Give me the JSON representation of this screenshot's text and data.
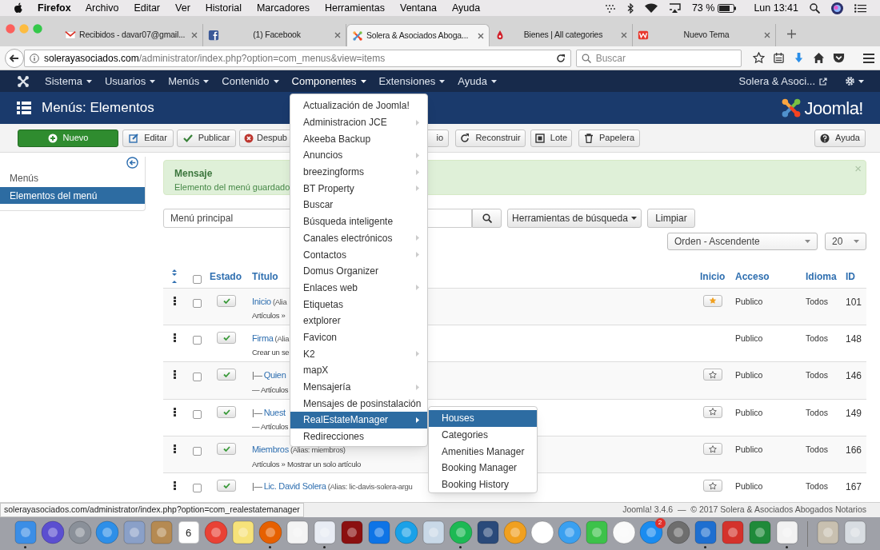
{
  "menubar": {
    "app": "Firefox",
    "items": [
      "Archivo",
      "Editar",
      "Ver",
      "Historial",
      "Marcadores",
      "Herramientas",
      "Ventana",
      "Ayuda"
    ],
    "battery": "73 %",
    "clock": "Lun 13:41"
  },
  "browser": {
    "tabs": [
      {
        "title": "Recibidos - davar07@gmail...",
        "selected": false
      },
      {
        "title": "(1) Facebook",
        "selected": false
      },
      {
        "title": "Solera & Asociados Aboga...",
        "selected": true
      },
      {
        "title": "Bienes | All categories",
        "selected": false
      },
      {
        "title": "Nuevo Tema",
        "selected": false
      }
    ],
    "url_host": "solerayasociados.com",
    "url_path": "/administrator/index.php?option=com_menus&view=items",
    "search_placeholder": "Buscar"
  },
  "admin_nav": {
    "items": [
      {
        "label": "Sistema",
        "selected": false
      },
      {
        "label": "Usuarios",
        "selected": false
      },
      {
        "label": "Menús",
        "selected": false
      },
      {
        "label": "Contenido",
        "selected": false
      },
      {
        "label": "Componentes",
        "selected": true
      },
      {
        "label": "Extensiones",
        "selected": false
      },
      {
        "label": "Ayuda",
        "selected": false
      }
    ],
    "site": "Solera & Asoci..."
  },
  "page_title": "Menús: Elementos",
  "logo": "Joomla!",
  "toolbar": {
    "buttons": [
      {
        "label": "Nuevo",
        "kind": "new"
      },
      {
        "label": "Editar",
        "kind": "edit"
      },
      {
        "label": "Publicar",
        "kind": "publish"
      },
      {
        "label": "Despub",
        "kind": "unpublish"
      },
      {
        "label": "io",
        "kind": "home"
      },
      {
        "label": "Reconstruir",
        "kind": "rebuild"
      },
      {
        "label": "Lote",
        "kind": "batch"
      },
      {
        "label": "Papelera",
        "kind": "trash"
      },
      {
        "label": "Ayuda",
        "kind": "help"
      }
    ]
  },
  "sidebar": {
    "items": [
      {
        "label": "Menús",
        "selected": false
      },
      {
        "label": "Elementos del menú",
        "selected": true
      }
    ]
  },
  "message": {
    "heading": "Mensaje",
    "text": "Elemento del menú guardado",
    "close": "×"
  },
  "filters": {
    "menu": "Menú principal",
    "tools": "Herramientas de búsqueda",
    "clear": "Limpiar",
    "ordering": "Orden - Ascendente",
    "limit": "20"
  },
  "table": {
    "select_all_checked": false,
    "columns": [
      "Estado",
      "Título",
      "Inicio",
      "Acceso",
      "Idioma",
      "ID"
    ],
    "rows": [
      {
        "prefix": "",
        "title": "Inicio",
        "alias": "(Alia",
        "meta": "Artículos »",
        "published": true,
        "home": true,
        "access": "Publico",
        "language": "Todos",
        "id": "101",
        "checked": false
      },
      {
        "prefix": "",
        "title": "Firma",
        "alias": "(Alia",
        "meta": "Crear un se",
        "published": true,
        "access": "Publico",
        "language": "Todos",
        "id": "148",
        "checked": false
      },
      {
        "prefix": "|—",
        "title": "Quien",
        "alias": "",
        "meta": "— Artículos",
        "published": true,
        "home": false,
        "access": "Publico",
        "language": "Todos",
        "id": "146",
        "checked": false
      },
      {
        "prefix": "|—",
        "title": "Nuest",
        "alias": "",
        "meta": "— Artículos",
        "published": true,
        "home": false,
        "access": "Publico",
        "language": "Todos",
        "id": "149",
        "checked": false
      },
      {
        "prefix": "",
        "title": "Miembros",
        "alias": "(Alias: miembros)",
        "meta": "Artículos » Mostrar un solo artículo",
        "published": true,
        "home": false,
        "access": "Publico",
        "language": "Todos",
        "id": "166",
        "checked": false
      },
      {
        "prefix": "|—",
        "title": "Lic. David Solera",
        "alias": "(Alias: lic-davis-solera-argu",
        "meta": "",
        "published": true,
        "home": false,
        "access": "Publico",
        "language": "Todos",
        "id": "167",
        "checked": false
      }
    ]
  },
  "components_menu": {
    "items": [
      {
        "label": "Actualización de Joomla!",
        "submenu": false,
        "selected": false
      },
      {
        "label": "Administracion JCE",
        "submenu": true,
        "selected": false
      },
      {
        "label": "Akeeba Backup",
        "submenu": false,
        "selected": false
      },
      {
        "label": "Anuncios",
        "submenu": true,
        "selected": false
      },
      {
        "label": "breezingforms",
        "submenu": true,
        "selected": false
      },
      {
        "label": "BT Property",
        "submenu": true,
        "selected": false
      },
      {
        "label": "Buscar",
        "submenu": false,
        "selected": false
      },
      {
        "label": "Búsqueda inteligente",
        "submenu": false,
        "selected": false
      },
      {
        "label": "Canales electrónicos",
        "submenu": true,
        "selected": false
      },
      {
        "label": "Contactos",
        "submenu": true,
        "selected": false
      },
      {
        "label": "Domus Organizer",
        "submenu": false,
        "selected": false
      },
      {
        "label": "Enlaces web",
        "submenu": true,
        "selected": false
      },
      {
        "label": "Etiquetas",
        "submenu": false,
        "selected": false
      },
      {
        "label": "extplorer",
        "submenu": false,
        "selected": false
      },
      {
        "label": "Favicon",
        "submenu": false,
        "selected": false
      },
      {
        "label": "K2",
        "submenu": true,
        "selected": false
      },
      {
        "label": "mapX",
        "submenu": false,
        "selected": false
      },
      {
        "label": "Mensajería",
        "submenu": true,
        "selected": false
      },
      {
        "label": "Mensajes de posinstalación",
        "submenu": false,
        "selected": false
      },
      {
        "label": "RealEstateManager",
        "submenu": true,
        "selected": true
      },
      {
        "label": "Redirecciones",
        "submenu": false,
        "selected": false
      }
    ],
    "submenu": [
      {
        "label": "Houses",
        "selected": true
      },
      {
        "label": "Categories",
        "selected": false
      },
      {
        "label": "Amenities Manager",
        "selected": false
      },
      {
        "label": "Booking Manager",
        "selected": false
      },
      {
        "label": "Booking History",
        "selected": false
      }
    ]
  },
  "status": {
    "link": "solerayasociados.com/administrator/index.php?option=com_realestatemanager",
    "footer": "Joomla! 3.4.6  —  © 2017 Solera & Asociados Abogados Notarios"
  },
  "dock": {
    "items": [
      {
        "kind": "app",
        "running": true
      },
      {
        "kind": "app",
        "running": false
      },
      {
        "kind": "app",
        "running": false
      },
      {
        "kind": "app",
        "running": false
      },
      {
        "kind": "app",
        "running": false
      },
      {
        "kind": "app",
        "running": false
      },
      {
        "kind": "app",
        "running": false,
        "label": "6"
      },
      {
        "kind": "app",
        "running": false
      },
      {
        "kind": "app",
        "running": false
      },
      {
        "kind": "app",
        "running": true
      },
      {
        "kind": "app",
        "running": false
      },
      {
        "kind": "app",
        "running": true
      },
      {
        "kind": "app",
        "running": false
      },
      {
        "kind": "app",
        "running": false
      },
      {
        "kind": "app",
        "running": false
      },
      {
        "kind": "app",
        "running": false
      },
      {
        "kind": "app",
        "running": true
      },
      {
        "kind": "app",
        "running": false
      },
      {
        "kind": "app",
        "running": false
      },
      {
        "kind": "app",
        "running": false
      },
      {
        "kind": "app",
        "running": false
      },
      {
        "kind": "app",
        "running": false
      },
      {
        "kind": "app",
        "running": false
      },
      {
        "kind": "app",
        "running": false,
        "badge": "2"
      },
      {
        "kind": "app",
        "running": false
      },
      {
        "kind": "app",
        "running": true
      },
      {
        "kind": "app",
        "running": false
      },
      {
        "kind": "app",
        "running": false
      },
      {
        "kind": "app",
        "running": true
      },
      {
        "kind": "separator"
      },
      {
        "kind": "app",
        "running": false
      },
      {
        "kind": "app",
        "running": false
      }
    ]
  }
}
